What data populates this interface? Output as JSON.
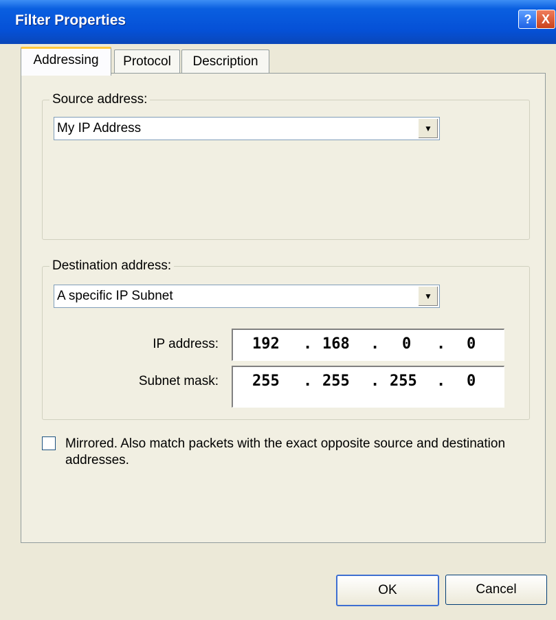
{
  "window": {
    "title": "Filter Properties",
    "help_label": "?",
    "close_label": "X"
  },
  "tabs": [
    {
      "label": "Addressing",
      "active": true
    },
    {
      "label": "Protocol",
      "active": false
    },
    {
      "label": "Description",
      "active": false
    }
  ],
  "source": {
    "group_label": "Source address:",
    "selected": "My IP Address"
  },
  "destination": {
    "group_label": "Destination address:",
    "selected": "A specific IP Subnet",
    "ip_label": "IP address:",
    "mask_label": "Subnet mask:",
    "ip_octets": [
      "192",
      "168",
      "0",
      "0"
    ],
    "mask_octets": [
      "255",
      "255",
      "255",
      "0"
    ]
  },
  "mirror": {
    "text": "Mirrored. Also match packets with the exact opposite source and destination addresses.",
    "checked": false
  },
  "buttons": {
    "ok": "OK",
    "cancel": "Cancel"
  },
  "colors": {
    "titlebar": "#0550d6",
    "background": "#ece9d8",
    "accent": "#ffc83c"
  }
}
